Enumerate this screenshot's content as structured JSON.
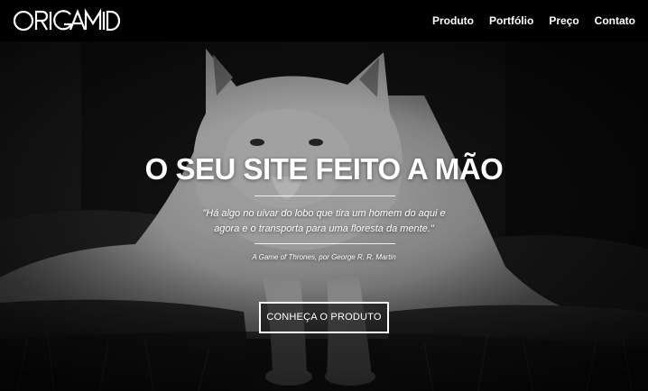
{
  "header": {
    "logo_text": "ORIGAMID",
    "nav": [
      {
        "label": "Produto"
      },
      {
        "label": "Portfólio"
      },
      {
        "label": "Preço"
      },
      {
        "label": "Contato"
      }
    ]
  },
  "hero": {
    "background": "black-and-white photo of a white wolf lying on dark grass",
    "title": "O SEU SITE FEITO A MÃO",
    "quote": "\"Há algo no uivar do lobo que tira um homem do aqui e agora e o transporta para uma floresta da mente.\"",
    "quote_source": "A Game of Thrones, por George R. R. Martin",
    "cta_label": "CONHEÇA O PRODUTO"
  },
  "colors": {
    "header_bg": "#000000",
    "text": "#ffffff",
    "cta_border": "#ffffff"
  }
}
